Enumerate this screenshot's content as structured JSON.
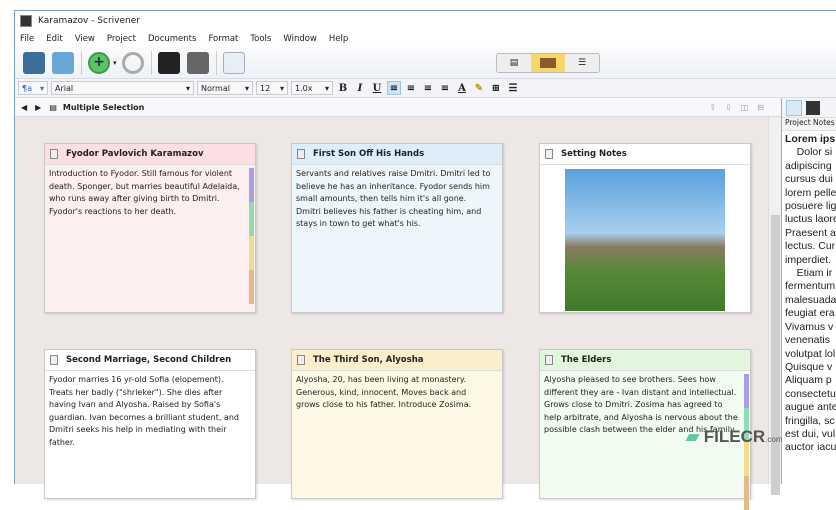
{
  "window": {
    "title": "Karamazov - Scrivener"
  },
  "menu": [
    "File",
    "Edit",
    "View",
    "Project",
    "Documents",
    "Format",
    "Tools",
    "Window",
    "Help"
  ],
  "format": {
    "font": "Arial",
    "style": "Normal",
    "size": "12",
    "spacing": "1.0x",
    "bold": "B",
    "italic": "I",
    "underline": "U",
    "text_color": "A"
  },
  "header": {
    "title": "Multiple Selection"
  },
  "cards": [
    {
      "title": "Fyodor Pavlovich Karamazov",
      "text": "Introduction to Fyodor. Still famous for violent death. Sponger, but marries beautiful Adelaida, who runs away after giving birth to Dmitri. Fyodor's reactions to her death.",
      "bg": "#fdeef0",
      "hbg": "#fbdfe3"
    },
    {
      "title": "First Son Off His Hands",
      "text": "Servants and relatives raise Dmitri. Dmitri led to believe he has an inheritance. Fyodor sends him small amounts, then tells him it's all gone. Dmitri believes his father is cheating him, and stays in town to get what's his.",
      "bg": "#eef6fb",
      "hbg": "#ddeefa"
    },
    {
      "title": "Setting Notes",
      "text": "",
      "bg": "#ffffff",
      "hbg": "#ffffff"
    },
    {
      "title": "Second Marriage, Second Children",
      "text": "Fyodor marries 16 yr-old Sofia (elopement). Treats her badly (\"shrieker\"). She dies after having Ivan and Alyosha. Raised by Sofia's guardian. Ivan becomes a brilliant student, and Dmitri seeks his help in mediating with their father.",
      "bg": "#ffffff",
      "hbg": "#ffffff"
    },
    {
      "title": "The Third Son, Alyosha",
      "text": "Alyosha, 20, has been living at monastery. Generous, kind, innocent. Moves back and grows close to his father. Introduce Zosima.",
      "bg": "#fdf7e4",
      "hbg": "#fbefcb"
    },
    {
      "title": "The Elders",
      "text": "Alyosha pleased to see brothers. Sees how different they are - Ivan distant and intellectual. Grows close to Dmitri. Zosima has agreed to help arbitrate, and Alyosha is nervous about the possible clash between the elder and his family.",
      "bg": "#f1fbef",
      "hbg": "#e1f6dd"
    }
  ],
  "right": {
    "label": "Project Notes",
    "notes": [
      "Lorem ips",
      "    Dolor si",
      "adipiscing",
      "cursus dui",
      "lorem pelle",
      "posuere lig",
      "luctus laore",
      "Praesent a",
      "lectus. Cur",
      "imperdiet.",
      "    Etiam ir",
      "fermentum",
      "malesuada",
      "feugiat era",
      "Vivamus v",
      "venenatis",
      "volutpat lol",
      "Quisque v",
      "Aliquam p",
      "consectetu",
      "augue ante",
      "fringilla, sc",
      "est dui, vul",
      "auctor iacu"
    ]
  },
  "watermark": "FILECR .com"
}
